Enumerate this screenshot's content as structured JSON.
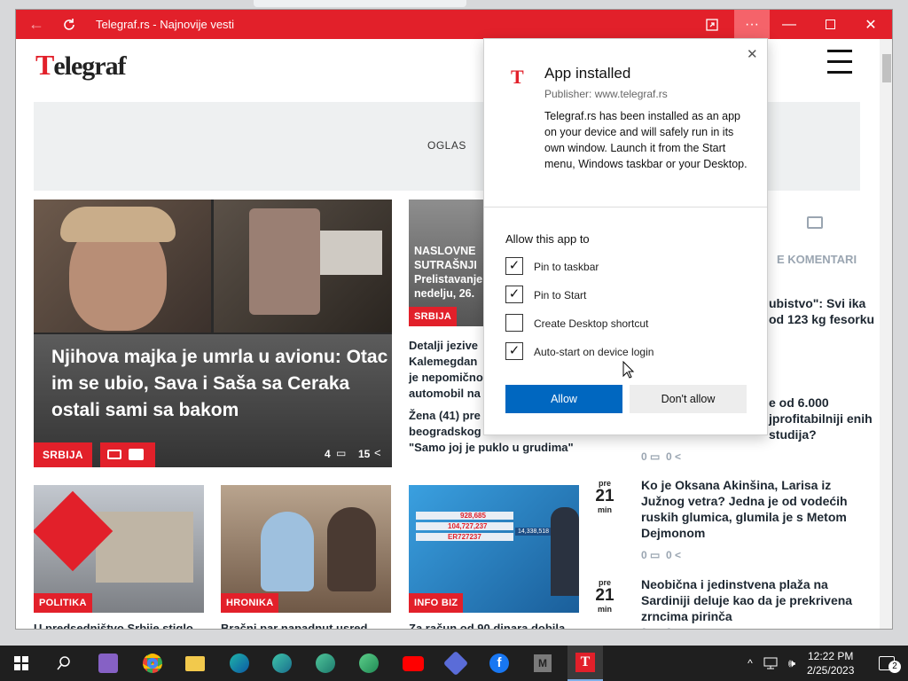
{
  "window": {
    "title": "Telegraf.rs - Najnovije vesti",
    "colors": {
      "titlebar": "#e2202a",
      "accent": "#e2202a",
      "primary_button": "#0067c0"
    }
  },
  "site": {
    "logo": "Telegraf",
    "ad_label": "OGLAS",
    "sidebar_heading": "KOMENTARI"
  },
  "hero": {
    "headline": "Njihova majka je umrla u avionu: Otac im se ubio, Sava i Saša sa Ceraka ostali sami sa bakom",
    "category": "SRBIJA",
    "comments": "4",
    "shares": "15"
  },
  "middle": {
    "card_category": "SRBIJA",
    "card_overlay": "NASLOVNE SUTRAŠNJI Prelistavanje nedelju, 26.",
    "story1": "Detalji jezive Kalemegdan je nepomično automobil na",
    "story2": "Žena (41) pre uzletanju avi beogradskog aerodroma: \"Samo joj je puklo u grudima\""
  },
  "sidebar": {
    "items": [
      {
        "text": "ubistvo\": Svi ika od 123 kg fesorku"
      },
      {
        "text": "e od 6.000 jprofitabilniji enih studija?",
        "comments": "0",
        "shares": "0"
      },
      {
        "pre": "pre",
        "num": "21",
        "unit": "min",
        "text": "Ko je Oksana Akinšina, Larisa iz Južnog vetra? Jedna je od vodećih ruskih glumica, glumila je s Metom Dejmonom",
        "comments": "0",
        "shares": "0"
      },
      {
        "pre": "pre",
        "num": "21",
        "unit": "min",
        "text": "Neobična i jedinstvena plaža na Sardiniji deluje kao da je prekrivena zrncima pirinča",
        "comments": "0",
        "shares": "0"
      }
    ]
  },
  "bottom": {
    "cards": [
      {
        "category": "POLITIKA",
        "headline": "U predsedništvo Srbije stiglo"
      },
      {
        "category": "HRONIKA",
        "headline": "Bračni par napadnut usred"
      },
      {
        "category": "INFO BIZ",
        "headline": "Za račun od 90 dinara dobila"
      }
    ],
    "tv_values": [
      "928,685",
      "104,727,237",
      "14,338,518",
      "ER727237"
    ]
  },
  "popup": {
    "title": "App installed",
    "publisher": "Publisher: www.telegraf.rs",
    "description": "Telegraf.rs has been installed as an app on your device and will safely run in its own window. Launch it from the Start menu, Windows taskbar or your Desktop.",
    "allow_title": "Allow this app to",
    "options": [
      {
        "label": "Pin to taskbar",
        "checked": true
      },
      {
        "label": "Pin to Start",
        "checked": true
      },
      {
        "label": "Create Desktop shortcut",
        "checked": false
      },
      {
        "label": "Auto-start on device login",
        "checked": true
      }
    ],
    "allow_button": "Allow",
    "deny_button": "Don't allow"
  },
  "taskbar": {
    "time": "12:22 PM",
    "date": "2/25/2023",
    "notification_count": "2"
  }
}
